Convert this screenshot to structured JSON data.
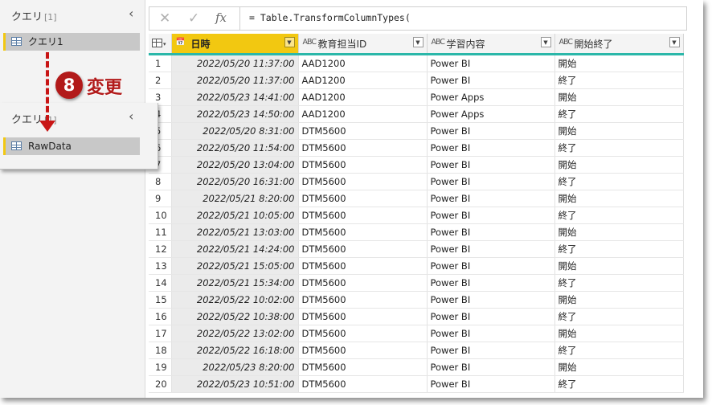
{
  "queries_pane": {
    "header": "クエリ",
    "count": "[1]",
    "collapse": "‹",
    "item": "クエリ1"
  },
  "overlay": {
    "header": "クエリ",
    "count": "[1]",
    "collapse": "‹",
    "item": "RawData"
  },
  "annotation": {
    "step_number": "8",
    "step_label": "変更"
  },
  "formula_bar": {
    "cancel": "✕",
    "confirm": "✓",
    "fx": "fx",
    "text": "= Table.TransformColumnTypes("
  },
  "columns": [
    {
      "type": "📅",
      "name": "日時"
    },
    {
      "type": "ABC",
      "name": "教育担当ID"
    },
    {
      "type": "ABC",
      "name": "学習内容"
    },
    {
      "type": "ABC",
      "name": "開始終了"
    }
  ],
  "rows": [
    {
      "n": "1",
      "dt": "2022/05/20 11:37:00",
      "id": "AAD1200",
      "course": "Power BI",
      "status": "開始"
    },
    {
      "n": "2",
      "dt": "2022/05/20 11:37:00",
      "id": "AAD1200",
      "course": "Power BI",
      "status": "終了"
    },
    {
      "n": "3",
      "dt": "2022/05/23 14:41:00",
      "id": "AAD1200",
      "course": "Power Apps",
      "status": "開始"
    },
    {
      "n": "4",
      "dt": "2022/05/23 14:50:00",
      "id": "AAD1200",
      "course": "Power Apps",
      "status": "終了"
    },
    {
      "n": "5",
      "dt": "2022/05/20 8:31:00",
      "id": "DTM5600",
      "course": "Power BI",
      "status": "開始"
    },
    {
      "n": "6",
      "dt": "2022/05/20 11:54:00",
      "id": "DTM5600",
      "course": "Power BI",
      "status": "終了"
    },
    {
      "n": "7",
      "dt": "2022/05/20 13:04:00",
      "id": "DTM5600",
      "course": "Power BI",
      "status": "開始"
    },
    {
      "n": "8",
      "dt": "2022/05/20 16:31:00",
      "id": "DTM5600",
      "course": "Power BI",
      "status": "終了"
    },
    {
      "n": "9",
      "dt": "2022/05/21 8:20:00",
      "id": "DTM5600",
      "course": "Power BI",
      "status": "開始"
    },
    {
      "n": "10",
      "dt": "2022/05/21 10:05:00",
      "id": "DTM5600",
      "course": "Power BI",
      "status": "終了"
    },
    {
      "n": "11",
      "dt": "2022/05/21 13:03:00",
      "id": "DTM5600",
      "course": "Power BI",
      "status": "開始"
    },
    {
      "n": "12",
      "dt": "2022/05/21 14:24:00",
      "id": "DTM5600",
      "course": "Power BI",
      "status": "終了"
    },
    {
      "n": "13",
      "dt": "2022/05/21 15:05:00",
      "id": "DTM5600",
      "course": "Power BI",
      "status": "開始"
    },
    {
      "n": "14",
      "dt": "2022/05/21 15:34:00",
      "id": "DTM5600",
      "course": "Power BI",
      "status": "終了"
    },
    {
      "n": "15",
      "dt": "2022/05/22 10:02:00",
      "id": "DTM5600",
      "course": "Power BI",
      "status": "開始"
    },
    {
      "n": "16",
      "dt": "2022/05/22 10:38:00",
      "id": "DTM5600",
      "course": "Power BI",
      "status": "終了"
    },
    {
      "n": "17",
      "dt": "2022/05/22 13:02:00",
      "id": "DTM5600",
      "course": "Power BI",
      "status": "開始"
    },
    {
      "n": "18",
      "dt": "2022/05/22 16:18:00",
      "id": "DTM5600",
      "course": "Power BI",
      "status": "終了"
    },
    {
      "n": "19",
      "dt": "2022/05/23 8:20:00",
      "id": "DTM5600",
      "course": "Power BI",
      "status": "開始"
    },
    {
      "n": "20",
      "dt": "2022/05/23 10:51:00",
      "id": "DTM5600",
      "course": "Power BI",
      "status": "終了"
    }
  ]
}
